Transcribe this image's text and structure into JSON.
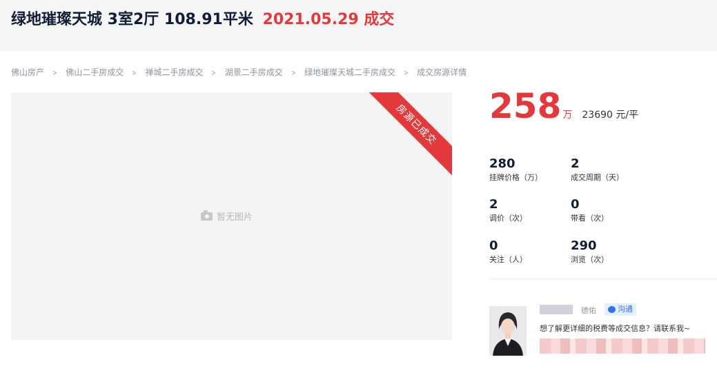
{
  "header": {
    "title": "绿地璀璨天城 3室2厅 108.91平米",
    "deal_info": "2021.05.29 成交"
  },
  "breadcrumb": {
    "items": [
      "佛山房产",
      "佛山二手房成交",
      "禅城二手房成交",
      "湖景二手房成交",
      "绿地璀璨天城二手房成交",
      "成交房源详情"
    ],
    "separator": ">"
  },
  "photo": {
    "ribbon": "房源已成交",
    "no_photo": "暂无图片",
    "icon": "camera-icon"
  },
  "price": {
    "total": "258",
    "total_unit": "万",
    "unit_price": "23690 元/平"
  },
  "stats": [
    {
      "value": "280",
      "label": "挂牌价格（万）"
    },
    {
      "value": "2",
      "label": "成交周期（天）"
    },
    {
      "value": "2",
      "label": "调价（次）"
    },
    {
      "value": "0",
      "label": "带看（次）"
    },
    {
      "value": "0",
      "label": "关注（人）"
    },
    {
      "value": "290",
      "label": "浏览（次）"
    }
  ],
  "agent": {
    "tag": "德佑",
    "chat_label": "沟通",
    "message": "想了解更详细的税费等成交信息？请联系我~"
  },
  "colors": {
    "accent": "#e4393c",
    "title": "#101d37",
    "chat": "#3072f6"
  }
}
